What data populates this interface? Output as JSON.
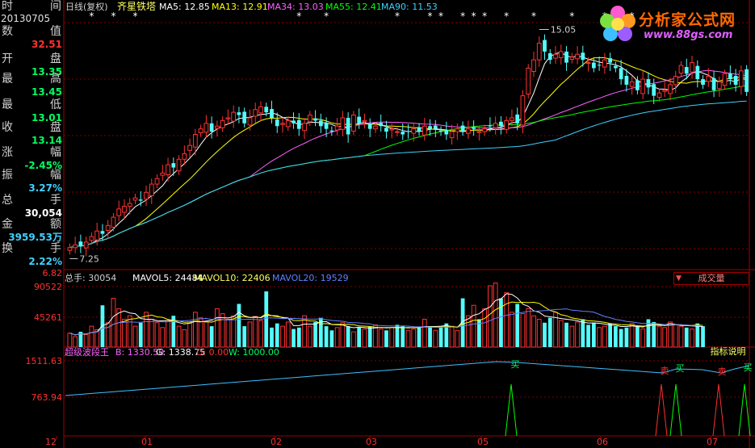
{
  "header": {
    "period": "日线(复权)",
    "stock_name": "齐星铁塔",
    "ma": [
      {
        "label": "MA5: 12.85",
        "color": "#ffffff"
      },
      {
        "label": "MA13: 12.91",
        "color": "#ffff00"
      },
      {
        "label": "MA34: 13.03",
        "color": "#ff60ff"
      },
      {
        "label": "MA55: 12.41",
        "color": "#00ff00"
      },
      {
        "label": "MA90: 11.53",
        "color": "#40d0ff"
      }
    ]
  },
  "sidebar": {
    "time_label_left": "时",
    "time_label_right": "间",
    "date": "20130705",
    "fields": [
      {
        "l": "数",
        "r": "值",
        "value": "32.51",
        "color": "#ff3030"
      },
      {
        "l": "开",
        "r": "盘",
        "value": "13.35",
        "color": "#00ff60"
      },
      {
        "l": "最",
        "r": "高",
        "value": "13.45",
        "color": "#00ff60"
      },
      {
        "l": "最",
        "r": "低",
        "value": "13.01",
        "color": "#00ff60"
      },
      {
        "l": "收",
        "r": "盘",
        "value": "13.14",
        "color": "#00ff60"
      },
      {
        "l": "涨",
        "r": "幅",
        "value": "-2.45%",
        "color": "#00ff60"
      },
      {
        "l": "振",
        "r": "幅",
        "value": "3.27%",
        "color": "#40d0ff"
      },
      {
        "l": "总",
        "r": "手",
        "value": "30,054",
        "color": "#ffffff"
      },
      {
        "l": "金",
        "r": "额",
        "value": "3959.53万",
        "color": "#40d0ff"
      },
      {
        "l": "换",
        "r": "手",
        "value": "2.22%",
        "color": "#40d0ff"
      }
    ]
  },
  "logo": {
    "title": "分析家公式网",
    "url": "www.88gs.com"
  },
  "volume_panel": {
    "items": [
      {
        "label": "总手: 30054",
        "color": "#d0d0d0"
      },
      {
        "label": "MAVOL5: 24484",
        "color": "#ffffff"
      },
      {
        "label": "MAVOL10: 22406",
        "color": "#ffff60"
      },
      {
        "label": "MAVOL20: 19529",
        "color": "#6080ff"
      }
    ],
    "button": "成交量",
    "y_ticks": [
      "90522",
      "45261"
    ]
  },
  "indicator_panel": {
    "name": "超级波段王",
    "items": [
      {
        "label": "B: 1330.50",
        "color": "#ff60ff"
      },
      {
        "label": "G: 1338.75",
        "color": "#ffffff"
      },
      {
        "label": "D: 0.00",
        "color": "#ff3030"
      },
      {
        "label": "W: 1000.00",
        "color": "#00ff60"
      }
    ],
    "button": "指标说明",
    "y_ticks": [
      "1511.63",
      "763.94"
    ],
    "signal_buy": "买",
    "signal_sell": "卖"
  },
  "price_panel": {
    "y_ticks": [
      "6.82"
    ],
    "high_mark": "15.05",
    "low_mark": "7.25"
  },
  "x_axis": {
    "labels": [
      "12",
      "01",
      "02",
      "03",
      "05",
      "06",
      "07"
    ]
  },
  "chart_data": [
    {
      "type": "candlestick",
      "title": "齐星铁塔 日线(复权)",
      "annotations": [
        "15.05",
        "7.25"
      ],
      "ylim": [
        6.82,
        16.0
      ],
      "close": [
        7.5,
        7.6,
        7.55,
        7.7,
        7.9,
        8.1,
        8.0,
        8.3,
        8.6,
        8.9,
        9.0,
        9.1,
        9.3,
        9.2,
        9.5,
        9.8,
        10.0,
        10.2,
        10.5,
        10.4,
        10.7,
        10.9,
        11.2,
        11.6,
        11.8,
        12.0,
        11.7,
        11.9,
        12.1,
        12.2,
        12.4,
        12.3,
        12.0,
        12.2,
        12.5,
        12.6,
        12.4,
        12.2,
        11.9,
        12.0,
        12.1,
        12.0,
        11.8,
        12.0,
        12.3,
        12.1,
        11.9,
        11.8,
        11.7,
        11.9,
        12.2,
        11.6,
        12.3,
        12.0,
        12.1,
        11.8,
        11.9,
        11.9,
        11.7,
        11.8,
        11.7,
        11.6,
        11.7,
        11.8,
        11.7,
        11.9,
        11.8,
        11.8,
        11.7,
        11.6,
        11.7,
        11.8,
        11.7,
        11.8,
        11.8,
        11.7,
        11.8,
        11.9,
        12.0,
        11.9,
        12.1,
        12.2,
        12.0,
        13.0,
        14.0,
        14.3,
        14.9,
        14.6,
        14.3,
        14.5,
        14.6,
        14.2,
        14.4,
        14.5,
        14.3,
        14.2,
        14.0,
        14.1,
        14.3,
        14.2,
        14.0,
        13.6,
        13.4,
        13.5,
        13.2,
        13.6,
        13.3,
        13.0,
        13.1,
        13.2,
        13.4,
        13.7,
        14.1,
        13.8,
        14.2,
        13.6,
        13.4,
        13.7,
        13.2,
        13.5,
        13.8,
        13.6,
        13.4,
        13.9,
        13.14
      ]
    },
    {
      "type": "bar",
      "title": "成交量",
      "series": [
        {
          "name": "总手",
          "values": [
            20,
            15,
            22,
            18,
            30,
            25,
            60,
            35,
            70,
            55,
            40,
            45,
            30,
            35,
            50,
            40,
            35,
            28,
            38,
            45,
            30,
            25,
            34,
            50,
            42,
            36,
            30,
            55,
            48,
            40,
            45,
            62,
            30,
            36,
            44,
            38,
            80,
            28,
            34,
            30,
            36,
            26,
            28,
            45,
            30,
            36,
            42,
            30,
            24,
            28,
            35,
            30,
            22,
            28,
            26,
            30,
            32,
            26,
            24,
            28,
            32,
            30,
            24,
            26,
            28,
            40,
            30,
            24,
            28,
            34,
            30,
            24,
            70,
            45,
            60,
            40,
            55,
            88,
            92,
            70,
            78,
            50,
            62,
            48,
            55,
            45,
            40,
            35,
            42,
            50,
            38,
            35,
            30,
            36,
            40,
            32,
            35,
            28,
            30,
            34,
            30,
            26,
            28,
            34,
            30,
            26,
            40,
            36,
            30,
            28,
            36,
            32,
            30,
            28,
            26,
            34,
            30
          ]
        }
      ],
      "ylim": [
        0,
        90522
      ]
    },
    {
      "type": "line",
      "title": "超级波段王",
      "series": [
        {
          "name": "B",
          "values": [
            1330.5
          ]
        },
        {
          "name": "G",
          "values": [
            1338.75
          ]
        },
        {
          "name": "D",
          "values": [
            0
          ]
        },
        {
          "name": "W",
          "values": [
            1000
          ]
        }
      ],
      "annotations": [
        "买",
        "卖"
      ]
    }
  ]
}
